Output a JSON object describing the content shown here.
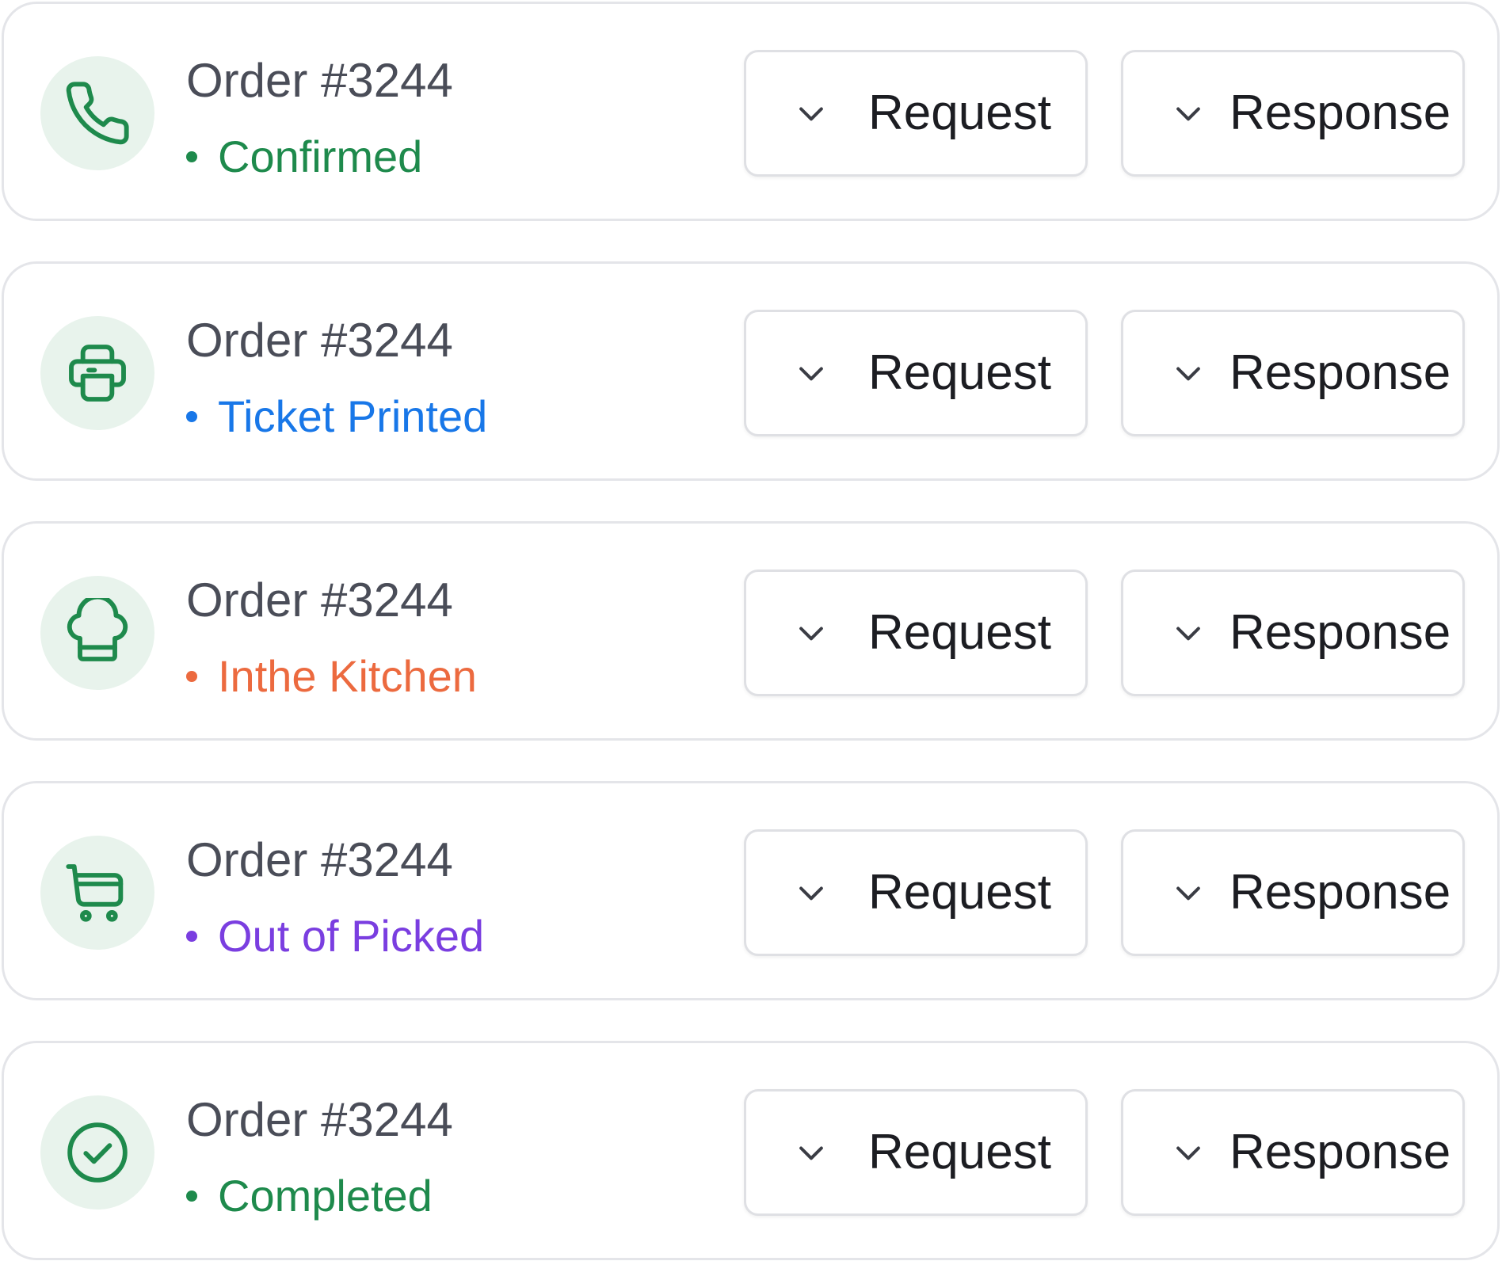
{
  "orders": [
    {
      "title": "Order #3244",
      "status": "Confirmed",
      "status_color": "#1e8a4c",
      "icon": "phone-icon",
      "request_label": "Request",
      "response_label": "Response"
    },
    {
      "title": "Order #3244",
      "status": "Ticket Printed",
      "status_color": "#1877e8",
      "icon": "printer-icon",
      "request_label": "Request",
      "response_label": "Response"
    },
    {
      "title": "Order #3244",
      "status": "Inthe Kitchen",
      "status_color": "#ec6a3f",
      "icon": "chef-hat-icon",
      "request_label": "Request",
      "response_label": "Response"
    },
    {
      "title": "Order #3244",
      "status": "Out of Picked",
      "status_color": "#7a3ee0",
      "icon": "cart-icon",
      "request_label": "Request",
      "response_label": "Response"
    },
    {
      "title": "Order #3244",
      "status": "Completed",
      "status_color": "#1e8a4c",
      "icon": "check-circle-icon",
      "request_label": "Request",
      "response_label": "Response"
    }
  ],
  "colors": {
    "icon_green": "#1e8a4c",
    "icon_bg": "#e8f3ec",
    "card_border": "#e4e5e9",
    "title_text": "#4a4d58",
    "button_text": "#1c1d22"
  }
}
